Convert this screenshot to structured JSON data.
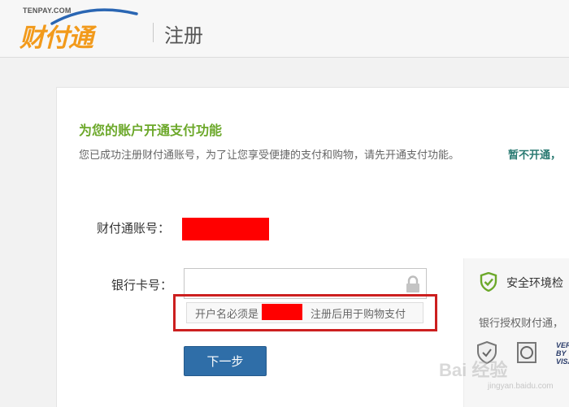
{
  "header": {
    "logo_small": "TENPAY.COM",
    "logo_main": "财付通",
    "title": "注册"
  },
  "main": {
    "section_title": "为您的账户开通支付功能",
    "section_desc": "您已成功注册财付通账号，为了让您享受便捷的支付和购物，请先开通支付功能。",
    "skip_link": "暂不开通，",
    "account_label": "财付通账号：",
    "card_label": "银行卡号：",
    "card_input_value": "",
    "hint_pre": "开户名必须是",
    "hint_post": "注册后用于购物支付",
    "next_button": "下一步"
  },
  "side_panel": {
    "title": "安全环境检",
    "desc": "银行授权财付通，",
    "visa_text": "VER BY VISA"
  },
  "watermark": {
    "text": "Bai 经验",
    "url": "jingyan.baidu.com"
  },
  "colors": {
    "accent_green": "#6ca82a",
    "button_blue": "#2f6ea8",
    "logo_orange": "#f29a1b",
    "highlight_red": "#cc1f1f",
    "redaction_red": "#ff0000"
  }
}
